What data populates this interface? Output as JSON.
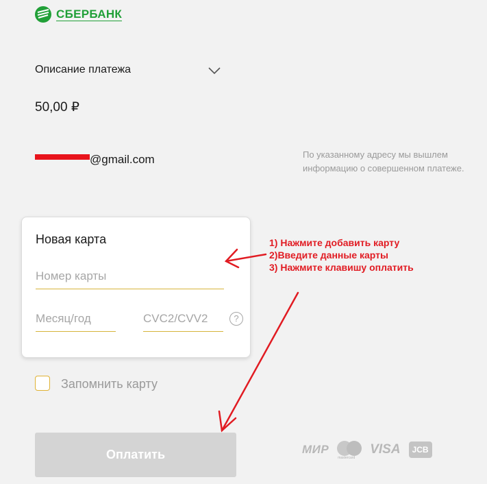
{
  "header": {
    "logo_text": "СБЕРБАНК"
  },
  "payment": {
    "description_label": "Описание платежа",
    "amount": "50,00 ₽",
    "email_domain": "@gmail.com",
    "email_note": "По указанному адресу мы вышлем информацию о совершенном платеже."
  },
  "card_form": {
    "title": "Новая карта",
    "card_number_placeholder": "Номер карты",
    "month_year_placeholder": "Месяц/год",
    "cvc_placeholder": "CVC2/CVV2",
    "help_symbol": "?"
  },
  "remember_card_label": "Запомнить карту",
  "pay_button_label": "Оплатить",
  "payment_systems": {
    "mir": "МИР",
    "mastercard": "mastercard",
    "visa": "VISA",
    "jcb": "JCB"
  },
  "instructions": [
    "1) Нажмите добавить карту",
    "2)Введите данные карты",
    "3) Нажмите клавишу оплатить"
  ],
  "colors": {
    "brand_green": "#21a038",
    "annotation_red": "#e11b22",
    "field_underline": "#d6b43a",
    "disabled_button": "#d4d4d4"
  }
}
